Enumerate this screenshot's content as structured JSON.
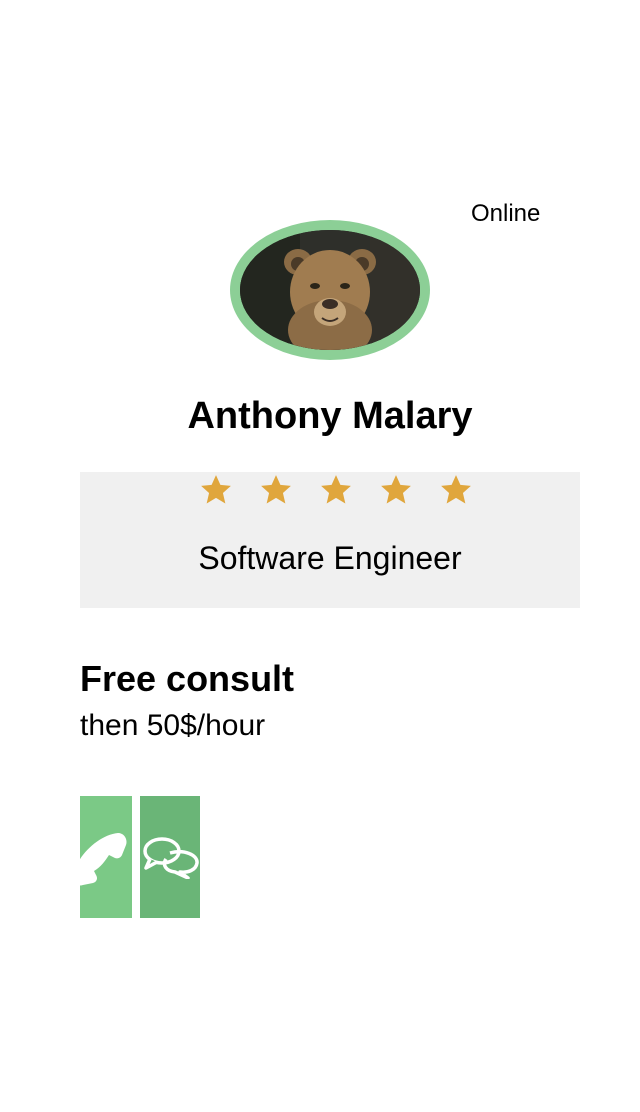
{
  "status": "Online",
  "profile": {
    "name": "Anthony Malary",
    "role": "Software Engineer",
    "rating": 5,
    "rating_max": 5
  },
  "offer": {
    "title": "Free consult",
    "price": "then 50$/hour"
  },
  "actions": [
    {
      "name": "call",
      "icon": "phone-icon"
    },
    {
      "name": "chat",
      "icon": "chat-bubbles-icon"
    }
  ],
  "colors": {
    "avatar_ring": "#8ccf96",
    "star": "#e0a63c",
    "card_background": "#f0f0f0",
    "call_button": "#7bc986",
    "chat_button": "#6ab577"
  }
}
